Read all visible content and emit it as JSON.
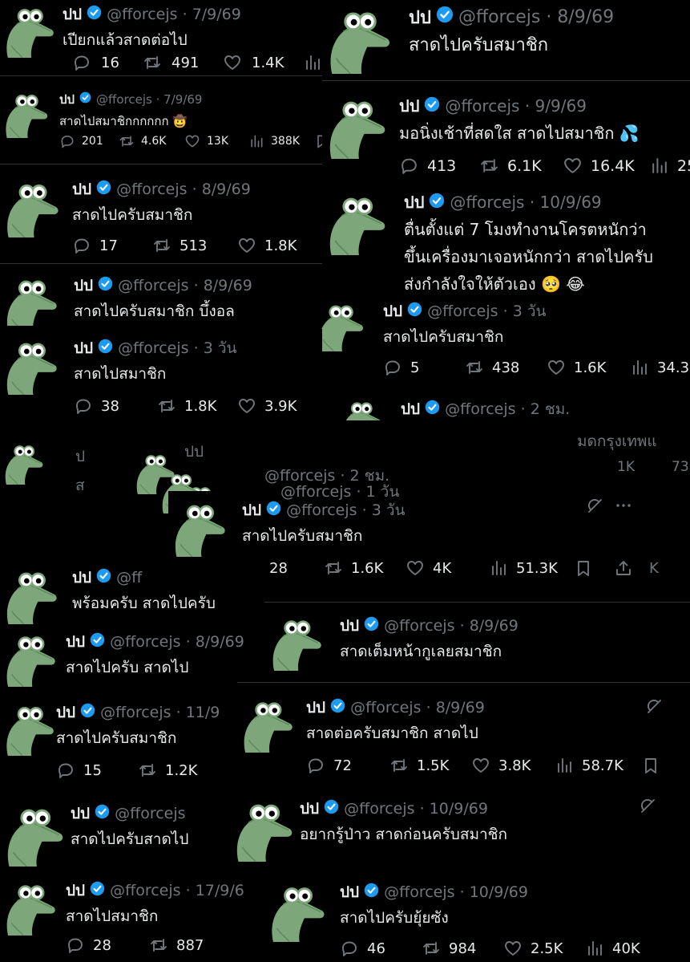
{
  "verified_color": "#1d9bf0",
  "icons": [
    "avatar-frog",
    "verified-badge",
    "reply-icon",
    "retweet-icon",
    "like-icon",
    "views-icon",
    "bookmark-icon",
    "share-icon",
    "grok-icon",
    "more-icon"
  ],
  "tweets": [
    {
      "name": "ปป",
      "handle": "@fforcejs",
      "date": "7/9/69",
      "text": [
        "เปียกแล้วสาดต่อไป"
      ],
      "reply": "16",
      "retweet": "491",
      "like": "1.4K",
      "views": ""
    },
    {
      "name": "ปป",
      "handle": "@fforcejs",
      "date": "8/9/69",
      "text": [
        "สาดไปครับสมาชิก"
      ]
    },
    {
      "name": "ปป",
      "handle": "@fforcejs",
      "date": "7/9/69",
      "text": [
        "สาดไปสมาชิกกกกกก 🤠"
      ],
      "reply": "201",
      "retweet": "4.6K",
      "like": "13K",
      "views": "388K"
    },
    {
      "name": "ปป",
      "handle": "@fforcejs",
      "date": "9/9/69",
      "text": [
        "มอนิ่งเช้าที่สดใส สาดไปสมาชิก 💦"
      ],
      "reply": "413",
      "retweet": "6.1K",
      "like": "16.4K",
      "views": "25"
    },
    {
      "name": "ปป",
      "handle": "@fforcejs",
      "date": "8/9/69",
      "text": [
        "สาดไปครับสมาชิก"
      ],
      "reply": "17",
      "retweet": "513",
      "like": "1.8K"
    },
    {
      "name": "ปป",
      "handle": "@fforcejs",
      "date": "10/9/69",
      "text": [
        "ตื่นตั้งแต่ 7 โมงทำงานโครตหนักว่า",
        "ขึ้นเครื่องมาเจอหนักกว่า สาดไปครับ",
        "ส่งกำลังใจให้ตัวเอง 🥺 😂"
      ]
    },
    {
      "name": "ปป",
      "handle": "@fforcejs",
      "date": "8/9/69",
      "text": [
        "สาดไปครับสมาชิก บึ้งอล"
      ]
    },
    {
      "name": "ปป",
      "handle": "@fforcejs",
      "date": "3 วัน",
      "text": [
        "สาดไปครับสมาชิก"
      ],
      "reply": "5",
      "retweet": "438",
      "like": "1.6K",
      "views": "34.3"
    },
    {
      "name": "ปป",
      "handle": "@fforcejs",
      "date": "3 วัน",
      "text": [
        "สาดไปสมาชิก"
      ],
      "reply": "38",
      "retweet": "1.8K",
      "like": "3.9K"
    },
    {
      "name": "ปป",
      "handle": "@fforcejs",
      "date": "2 ชม.",
      "text": []
    },
    {
      "name": "ปป",
      "handle": "@fforcejs",
      "date": "3 วัน",
      "text": [
        "สาดไปครับสมาชิก"
      ],
      "reply": "28",
      "retweet": "1.6K",
      "like": "4K",
      "views": "51.3K",
      "extra": "K"
    },
    {
      "name": "ปป",
      "handle": "@ff",
      "date": "",
      "text": [
        "พร้อมครับ สาดไปครับ"
      ]
    },
    {
      "name": "ปป",
      "handle": "@fforcejs",
      "date": "8/9/69",
      "text": [
        "สาดเต็มหน้ากูเลยสมาชิก"
      ]
    },
    {
      "name": "ปป",
      "handle": "@fforcejs",
      "date": "8/9/69",
      "text": [
        "สาดไปครับ สาดไป"
      ]
    },
    {
      "name": "ปป",
      "handle": "@fforcejs",
      "date": "11/9",
      "text": [
        "สาดไปครับสมาชิก"
      ],
      "reply": "15",
      "retweet": "1.2K"
    },
    {
      "name": "ปป",
      "handle": "@fforcejs",
      "date": "8/9/69",
      "text": [
        "สาดต่อครับสมาชิก สาดไป"
      ],
      "reply": "72",
      "retweet": "1.5K",
      "like": "3.8K",
      "views": "58.7K"
    },
    {
      "name": "ปป",
      "handle": "@fforcejs",
      "date": "",
      "text": [
        "สาดไปครับสาดไป"
      ]
    },
    {
      "name": "ปป",
      "handle": "@fforcejs",
      "date": "10/9/69",
      "text": [
        "อยากรู้ป่าว สาดก่อนครับสมาชิก"
      ]
    },
    {
      "name": "ปป",
      "handle": "@fforcejs",
      "date": "17/9/6",
      "text": [
        "สาดไปสมาชิก"
      ],
      "reply": "28",
      "retweet": "887"
    },
    {
      "name": "ปป",
      "handle": "@fforcejs",
      "date": "10/9/69",
      "text": [
        "สาดไปครับยุ้ยซัง"
      ],
      "reply": "46",
      "retweet": "984",
      "like": "2.5K",
      "views": "40K"
    }
  ],
  "fragments": [
    "ปป",
    "@fforcejs · 2 ชม.",
    "@fforcejs · 1 วัน",
    "มดกรุงเทพแ",
    "1K",
    "73",
    "ป",
    "ส"
  ]
}
